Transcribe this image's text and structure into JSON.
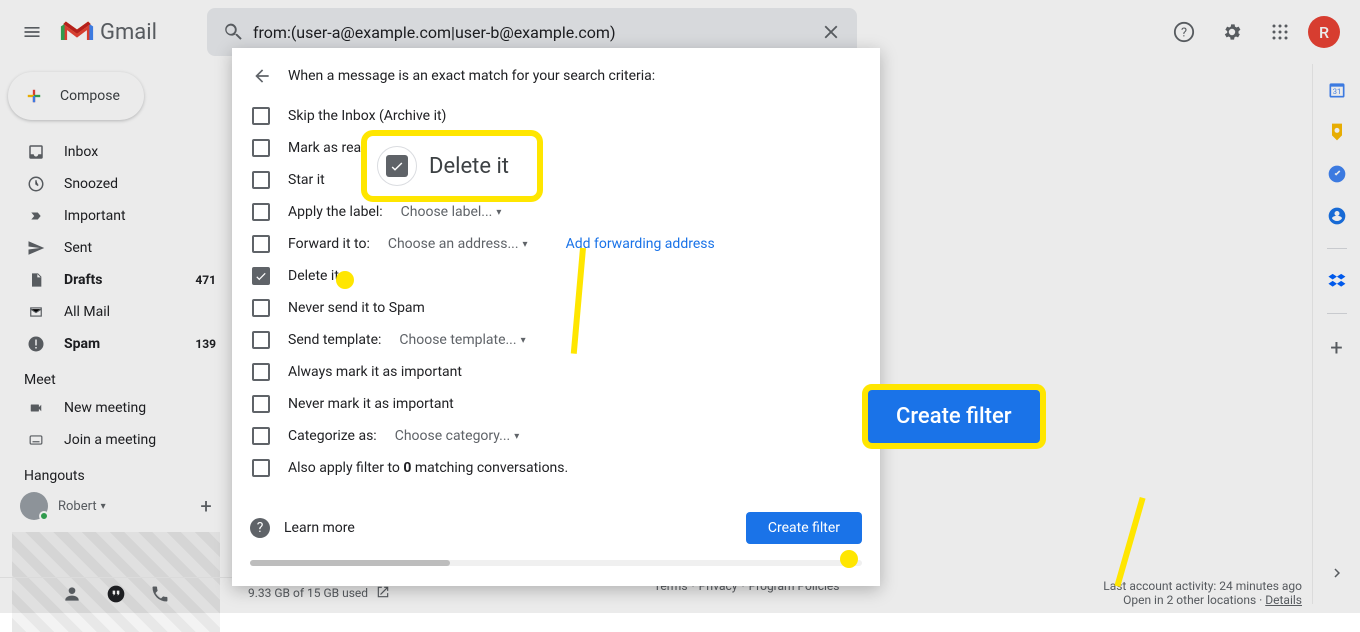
{
  "header": {
    "product": "Gmail",
    "search_value": "from:(user-a@example.com|user-b@example.com)",
    "avatar_initial": "R"
  },
  "compose": "Compose",
  "nav": [
    {
      "icon": "inbox",
      "label": "Inbox",
      "bold": false,
      "count": ""
    },
    {
      "icon": "snoozed",
      "label": "Snoozed",
      "bold": false,
      "count": ""
    },
    {
      "icon": "important",
      "label": "Important",
      "bold": false,
      "count": ""
    },
    {
      "icon": "sent",
      "label": "Sent",
      "bold": false,
      "count": ""
    },
    {
      "icon": "drafts",
      "label": "Drafts",
      "bold": true,
      "count": "471"
    },
    {
      "icon": "allmail",
      "label": "All Mail",
      "bold": false,
      "count": ""
    },
    {
      "icon": "spam",
      "label": "Spam",
      "bold": true,
      "count": "139"
    }
  ],
  "meet": {
    "title": "Meet",
    "new": "New meeting",
    "join": "Join a meeting"
  },
  "hangouts": {
    "title": "Hangouts",
    "user": "Robert"
  },
  "filter": {
    "heading": "When a message is an exact match for your search criteria:",
    "rows": [
      {
        "label": "Skip the Inbox (Archive it)",
        "checked": false,
        "extra": null
      },
      {
        "label": "Mark as read",
        "checked": false,
        "extra": null
      },
      {
        "label": "Star it",
        "checked": false,
        "extra": null
      },
      {
        "label": "Apply the label:",
        "checked": false,
        "extra": "Choose label..."
      },
      {
        "label": "Forward it to:",
        "checked": false,
        "extra": "Choose an address...",
        "action": "Add forwarding address"
      },
      {
        "label": "Delete it",
        "checked": true,
        "extra": null
      },
      {
        "label": "Never send it to Spam",
        "checked": false,
        "extra": null
      },
      {
        "label": "Send template:",
        "checked": false,
        "extra": "Choose template..."
      },
      {
        "label": "Always mark it as important",
        "checked": false,
        "extra": null
      },
      {
        "label": "Never mark it as important",
        "checked": false,
        "extra": null
      },
      {
        "label": "Categorize as:",
        "checked": false,
        "extra": "Choose category..."
      },
      {
        "label_html": "Also apply filter to <b>0</b> matching conversations.",
        "checked": false,
        "extra": null
      }
    ],
    "learn_more": "Learn more",
    "create": "Create filter"
  },
  "callout_delete": "Delete it",
  "callout_create": "Create filter",
  "footer": {
    "storage": "9.33 GB of 15 GB used",
    "links": [
      "Terms",
      "Privacy",
      "Program Policies"
    ],
    "activity_1": "Last account activity: 24 minutes ago",
    "activity_2": "Open in 2 other locations · ",
    "details": "Details"
  }
}
